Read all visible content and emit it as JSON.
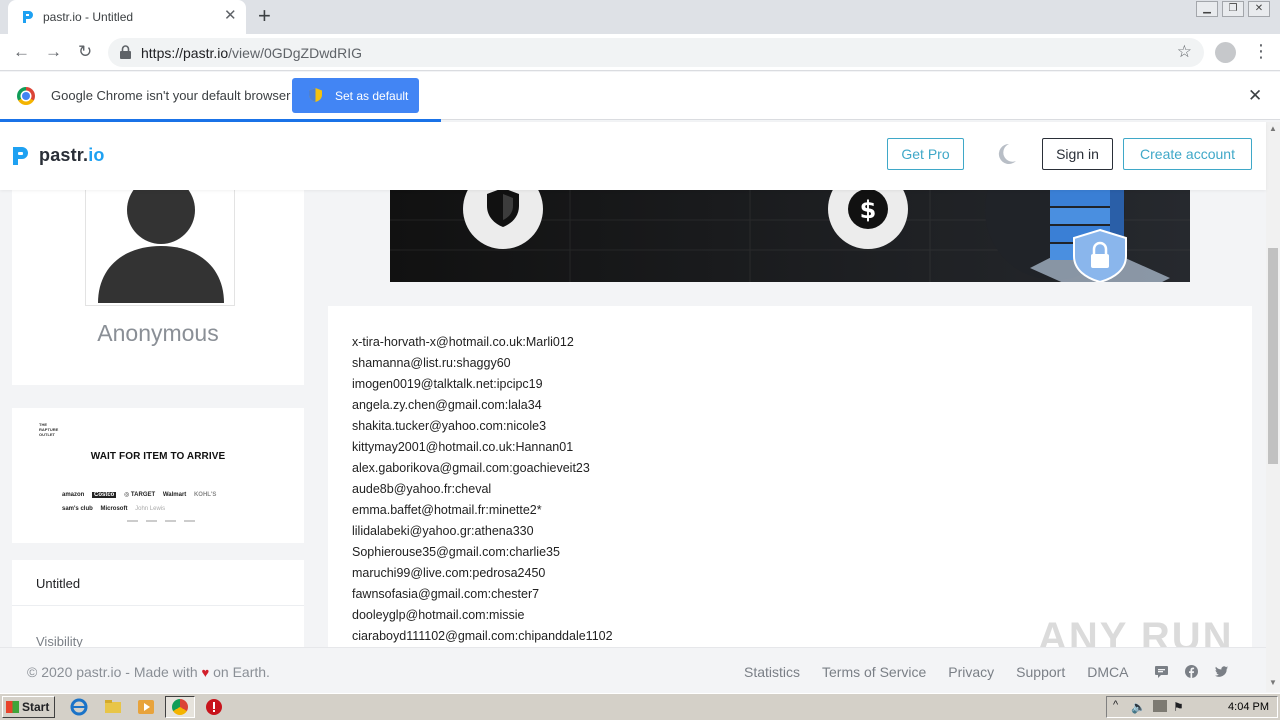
{
  "browser": {
    "tab_title": "pastr.io - Untitled",
    "url_host": "https://pastr.io",
    "url_path": "/view/0GDgZDwdRIG",
    "infobar_text": "Google Chrome isn't your default browser",
    "infobar_button": "Set as default"
  },
  "site": {
    "brand_main": "pastr.",
    "brand_suffix": "io",
    "nav": {
      "get_pro": "Get Pro",
      "sign_in": "Sign in",
      "create_account": "Create account"
    }
  },
  "profile": {
    "name": "Anonymous"
  },
  "ad": {
    "small_brand": "THE RAPTURE OUTLET",
    "headline": "WAIT FOR ITEM TO ARRIVE",
    "logos_row1": [
      "amazon",
      "Costco",
      "◎ TARGET",
      "Walmart",
      "KOHL'S"
    ],
    "logos_row2": [
      "sam's club",
      "Microsoft",
      "John Lewis"
    ]
  },
  "paste_meta": {
    "title": "Untitled",
    "visibility_label": "Visibility"
  },
  "paste_lines": [
    "x-tira-horvath-x@hotmail.co.uk:Marli012",
    "shamanna@list.ru:shaggy60",
    "imogen0019@talktalk.net:ipcipc19",
    "angela.zy.chen@gmail.com:lala34",
    "shakita.tucker@yahoo.com:nicole3",
    "kittymay2001@hotmail.co.uk:Hannan01",
    "alex.gaborikova@gmail.com:goachieveit23",
    "aude8b@yahoo.fr:cheval",
    "emma.baffet@hotmail.fr:minette2*",
    "lilidalabeki@yahoo.gr:athena330",
    "Sophierouse35@gmail.com:charlie35",
    "maruchi99@live.com:pedrosa2450",
    "fawnsofasia@gmail.com:chester7",
    "dooleyglp@hotmail.com:missie",
    "ciaraboyd111102@gmail.com:chipanddale1102"
  ],
  "footer": {
    "copyright_pre": "© 2020 pastr.io - Made with",
    "heart": "♥",
    "copyright_post": "on Earth.",
    "links": [
      "Statistics",
      "Terms of Service",
      "Privacy",
      "Support",
      "DMCA"
    ]
  },
  "watermark": "ANY RUN",
  "taskbar": {
    "start": "Start",
    "clock": "4:04 PM"
  },
  "colors": {
    "accent": "#3fa8c8",
    "brand_blue": "#1ea1f2",
    "chrome_blue": "#4285f4",
    "heart": "#d21f2b"
  }
}
